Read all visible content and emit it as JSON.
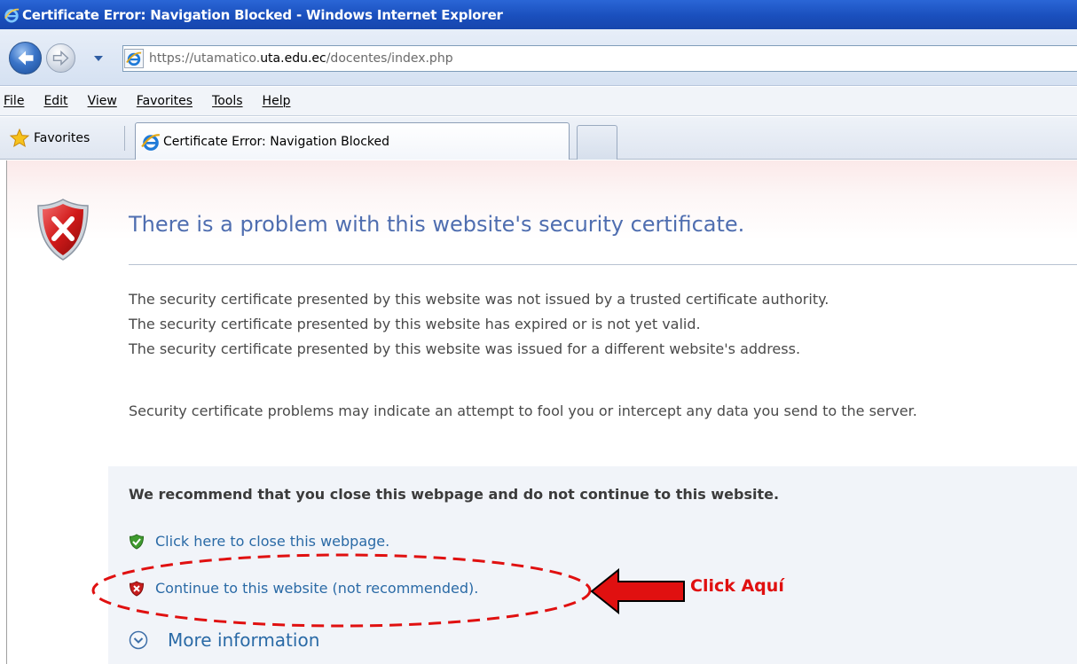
{
  "window": {
    "title": "Certificate Error: Navigation Blocked - Windows Internet Explorer"
  },
  "address_bar": {
    "url_prefix": "https://utamatico.",
    "url_domain": "uta.edu.ec",
    "url_suffix": "/docentes/index.php"
  },
  "menu": {
    "items": [
      "File",
      "Edit",
      "View",
      "Favorites",
      "Tools",
      "Help"
    ]
  },
  "favorites_bar": {
    "favorites_label": "Favorites",
    "tab_label": "Certificate Error: Navigation Blocked"
  },
  "page": {
    "heading": "There is a problem with this website's security certificate.",
    "reasons": [
      "The security certificate presented by this website was not issued by a trusted certificate authority.",
      "The security certificate presented by this website has expired or is not yet valid.",
      "The security certificate presented by this website was issued for a different website's address."
    ],
    "warning": "Security certificate problems may indicate an attempt to fool you or intercept any data you send to the server.",
    "recommendation": "We recommend that you close this webpage and do not continue to this website.",
    "close_link": "Click here to close this webpage.",
    "continue_link": "Continue to this website (not recommended).",
    "more_info": "More information"
  },
  "annotation": {
    "text": "Click Aquí",
    "color": "#e01010"
  },
  "colors": {
    "titlebar": "#1a4fbd",
    "heading": "#4f6eb0",
    "link": "#2a6aa6"
  }
}
